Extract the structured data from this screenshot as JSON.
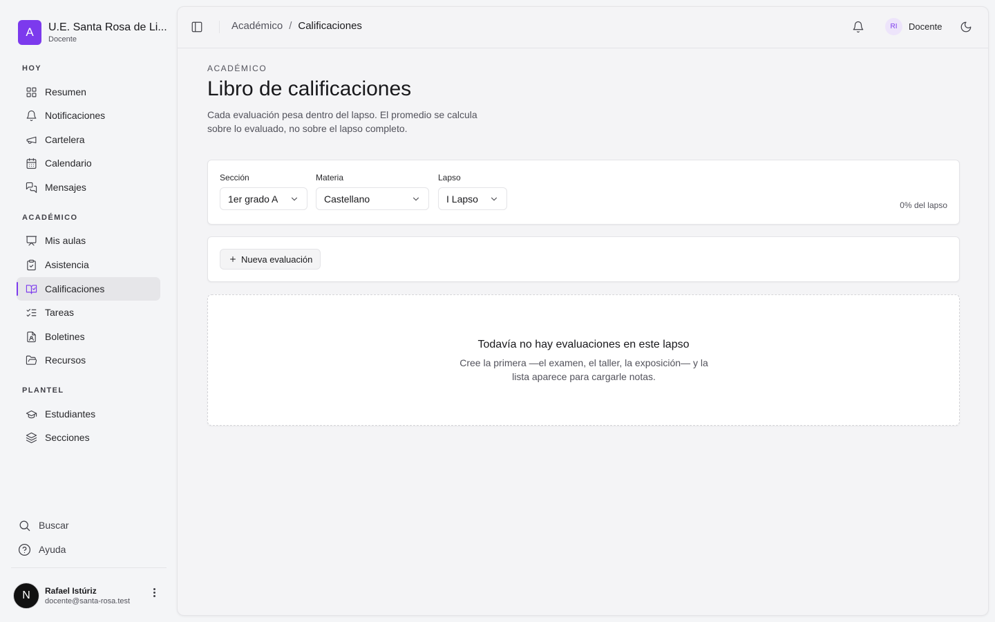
{
  "brand": {
    "logo_letter": "A",
    "name": "U.E. Santa Rosa de Li...",
    "role": "Docente",
    "accent_color": "#7c3aed"
  },
  "sidebar": {
    "groups": [
      {
        "label": "HOY",
        "items": [
          {
            "label": "Resumen",
            "icon": "grid-icon"
          },
          {
            "label": "Notificaciones",
            "icon": "bell-icon"
          },
          {
            "label": "Cartelera",
            "icon": "megaphone-icon"
          },
          {
            "label": "Calendario",
            "icon": "calendar-icon"
          },
          {
            "label": "Mensajes",
            "icon": "messages-icon"
          }
        ]
      },
      {
        "label": "ACADÉMICO",
        "items": [
          {
            "label": "Mis aulas",
            "icon": "presentation-icon"
          },
          {
            "label": "Asistencia",
            "icon": "clipboard-check-icon"
          },
          {
            "label": "Calificaciones",
            "icon": "book-check-icon",
            "active": true
          },
          {
            "label": "Tareas",
            "icon": "list-checks-icon"
          },
          {
            "label": "Boletines",
            "icon": "file-user-icon"
          },
          {
            "label": "Recursos",
            "icon": "folder-open-icon"
          }
        ]
      },
      {
        "label": "PLANTEL",
        "items": [
          {
            "label": "Estudiantes",
            "icon": "graduation-cap-icon"
          },
          {
            "label": "Secciones",
            "icon": "layers-icon"
          }
        ]
      }
    ],
    "bottom": {
      "search_label": "Buscar",
      "help_label": "Ayuda"
    },
    "user": {
      "avatar_letter": "N",
      "name": "Rafael Istúriz",
      "email": "docente@santa-rosa.test"
    }
  },
  "topbar": {
    "breadcrumb": {
      "parent": "Académico",
      "separator": "/",
      "current": "Calificaciones"
    },
    "user": {
      "initials": "RI",
      "role": "Docente"
    }
  },
  "page": {
    "eyebrow": "ACADÉMICO",
    "title": "Libro de calificaciones",
    "description": "Cada evaluación pesa dentro del lapso. El promedio se calcula sobre lo evaluado, no sobre el lapso completo."
  },
  "filters": {
    "seccion": {
      "label": "Sección",
      "value": "1er grado A"
    },
    "materia": {
      "label": "Materia",
      "value": "Castellano"
    },
    "lapso": {
      "label": "Lapso",
      "value": "I Lapso"
    },
    "progress_text": "0% del lapso",
    "progress_value": 0
  },
  "toolbar": {
    "new_evaluation_label": "Nueva evaluación"
  },
  "empty_state": {
    "title": "Todavía no hay evaluaciones en este lapso",
    "description": "Cree la primera —el examen, el taller, la exposición— y la lista aparece para cargarle notas."
  }
}
